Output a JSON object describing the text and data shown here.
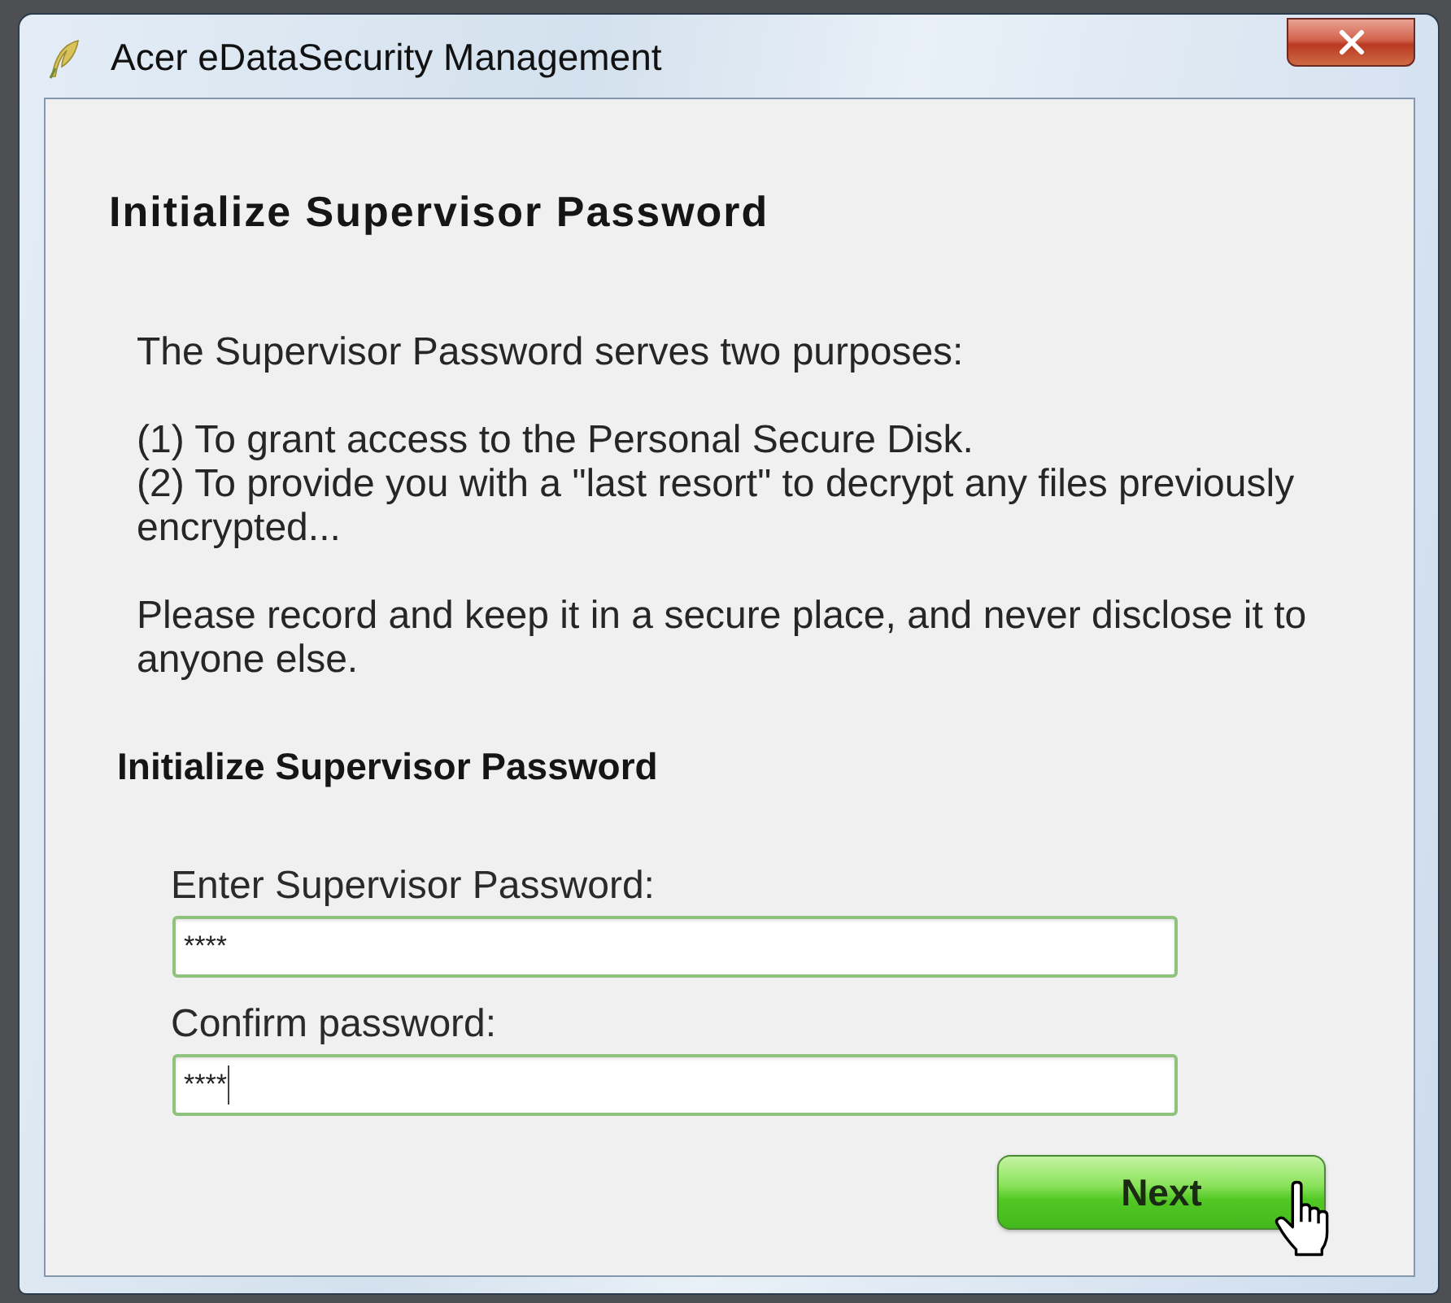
{
  "window": {
    "title": "Acer eDataSecurity Management"
  },
  "page": {
    "heading": "Initialize Supervisor Password",
    "intro": "The Supervisor Password serves two purposes:",
    "purposes": [
      "(1) To grant access to the Personal Secure Disk.",
      "(2) To provide you with a \"last resort\" to decrypt any files previously encrypted..."
    ],
    "notice": "Please record and keep it in a secure place, and never disclose it to anyone else."
  },
  "form": {
    "title": "Initialize Supervisor Password",
    "fields": [
      {
        "label": "Enter Supervisor Password:",
        "value": "****",
        "focused": false
      },
      {
        "label": "Confirm password:",
        "value": "****",
        "focused": true
      }
    ]
  },
  "next_button": {
    "label": "Next"
  }
}
